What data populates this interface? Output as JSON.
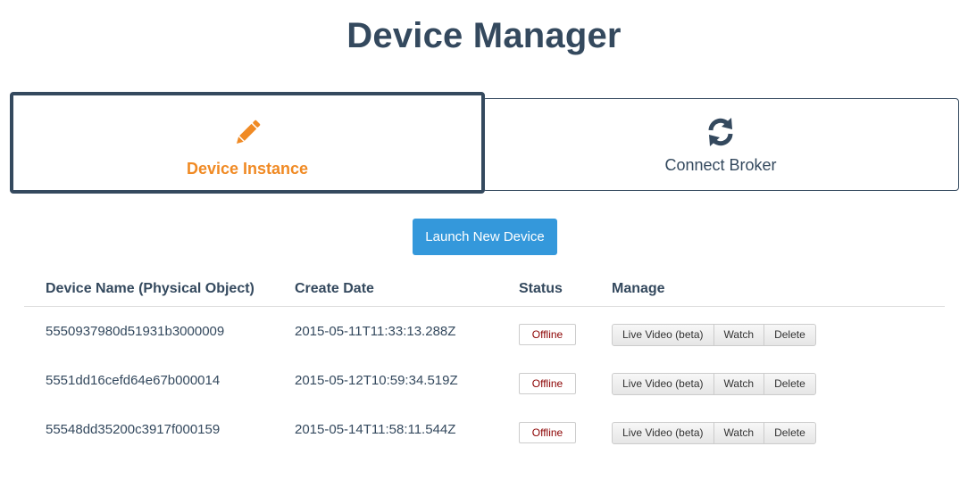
{
  "header": {
    "title": "Device Manager"
  },
  "tabs": [
    {
      "label": "Device Instance",
      "icon": "pencil-icon",
      "active": true,
      "color": "#f08a24"
    },
    {
      "label": "Connect Broker",
      "icon": "refresh-icon",
      "active": false,
      "color": "#34495e"
    }
  ],
  "launch_button": {
    "label": "Launch New Device",
    "color": "#3498db"
  },
  "table": {
    "headers": {
      "name": "Device Name (Physical Object)",
      "date": "Create Date",
      "status": "Status",
      "manage": "Manage"
    },
    "rows": [
      {
        "name": "5550937980d51931b3000009",
        "date": "2015-05-11T11:33:13.288Z",
        "status": "Offline"
      },
      {
        "name": "5551dd16cefd64e67b000014",
        "date": "2015-05-12T10:59:34.519Z",
        "status": "Offline"
      },
      {
        "name": "55548dd35200c3917f000159",
        "date": "2015-05-14T11:58:11.544Z",
        "status": "Offline"
      }
    ],
    "actions": {
      "live_video": "Live Video (beta)",
      "watch": "Watch",
      "delete": "Delete"
    }
  }
}
